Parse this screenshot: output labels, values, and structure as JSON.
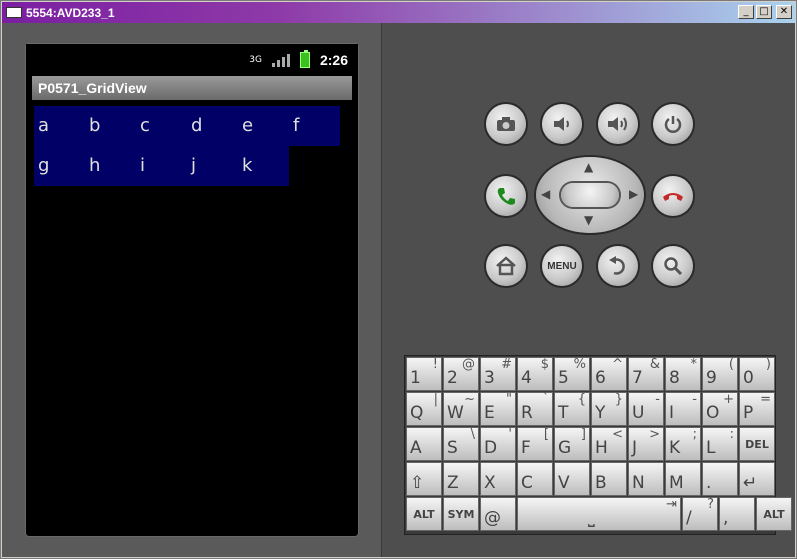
{
  "window": {
    "title": "5554:AVD233_1",
    "buttons": {
      "minimize": "_",
      "maximize": "□",
      "close": "✕"
    }
  },
  "status_bar": {
    "network": "3G",
    "time": "2:26"
  },
  "app": {
    "title": "P0571_GridView"
  },
  "grid": {
    "rows": [
      [
        "a",
        "b",
        "c",
        "d",
        "e",
        "f"
      ],
      [
        "g",
        "h",
        "i",
        "j",
        "k"
      ]
    ]
  },
  "controls": {
    "camera_icon": "camera-icon",
    "volume_down_icon": "volume-down-icon",
    "volume_up_icon": "volume-up-icon",
    "power_icon": "power-icon",
    "call_icon": "call-icon",
    "end_call_icon": "end-call-icon",
    "home_icon": "home-icon",
    "menu_label": "MENU",
    "back_icon": "back-icon",
    "search_icon": "search-icon"
  },
  "keyboard": {
    "rows": [
      [
        {
          "m": "1",
          "s": "!"
        },
        {
          "m": "2",
          "s": "@"
        },
        {
          "m": "3",
          "s": "#"
        },
        {
          "m": "4",
          "s": "$"
        },
        {
          "m": "5",
          "s": "%"
        },
        {
          "m": "6",
          "s": "^"
        },
        {
          "m": "7",
          "s": "&"
        },
        {
          "m": "8",
          "s": "*"
        },
        {
          "m": "9",
          "s": "("
        },
        {
          "m": "0",
          "s": ")"
        }
      ],
      [
        {
          "m": "Q",
          "s": "|"
        },
        {
          "m": "W",
          "s": "~"
        },
        {
          "m": "E",
          "s": "\""
        },
        {
          "m": "R",
          "s": "`"
        },
        {
          "m": "T",
          "s": "{"
        },
        {
          "m": "Y",
          "s": "}"
        },
        {
          "m": "U",
          "s": "-"
        },
        {
          "m": "I",
          "s": "-"
        },
        {
          "m": "O",
          "s": "+"
        },
        {
          "m": "P",
          "s": "="
        }
      ],
      [
        {
          "m": "A",
          "s": ""
        },
        {
          "m": "S",
          "s": "\\"
        },
        {
          "m": "D",
          "s": "'"
        },
        {
          "m": "F",
          "s": "["
        },
        {
          "m": "G",
          "s": "]"
        },
        {
          "m": "H",
          "s": "<"
        },
        {
          "m": "J",
          "s": ">"
        },
        {
          "m": "K",
          "s": ";"
        },
        {
          "m": "L",
          "s": ":"
        },
        {
          "m": "DEL",
          "s": ""
        }
      ],
      [
        {
          "m": "⇧",
          "s": ""
        },
        {
          "m": "Z",
          "s": ""
        },
        {
          "m": "X",
          "s": ""
        },
        {
          "m": "C",
          "s": ""
        },
        {
          "m": "V",
          "s": ""
        },
        {
          "m": "B",
          "s": ""
        },
        {
          "m": "N",
          "s": ""
        },
        {
          "m": "M",
          "s": ""
        },
        {
          "m": ".",
          "s": ""
        },
        {
          "m": "↵",
          "s": ""
        }
      ],
      [
        {
          "m": "ALT",
          "s": ""
        },
        {
          "m": "SYM",
          "s": ""
        },
        {
          "m": "@",
          "s": ""
        },
        {
          "m": "⎵",
          "s": "⇥"
        },
        {
          "m": "/",
          "s": "?"
        },
        {
          "m": ",",
          "s": ""
        },
        {
          "m": "ALT",
          "s": ""
        }
      ]
    ]
  }
}
